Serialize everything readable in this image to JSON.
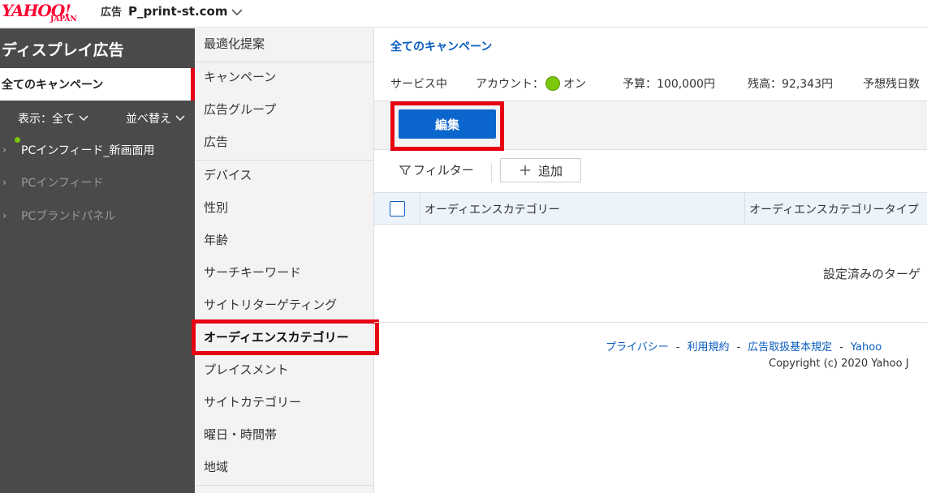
{
  "header": {
    "logo_text": "YAHOO!",
    "logo_sub": "JAPAN",
    "logo_ad": "広告",
    "account_name": "P_print-st.com"
  },
  "sidebar": {
    "title": "ディスプレイ広告",
    "active_item": "全てのキャンペーン",
    "filter_label": "表示：全て",
    "sort_label": "並べ替え",
    "campaigns": [
      {
        "label": "PCインフィード_新画面用",
        "status": "active"
      },
      {
        "label": "PCインフィード",
        "status": "inactive"
      },
      {
        "label": "PCブランドパネル",
        "status": "inactive"
      }
    ]
  },
  "midnav": {
    "items": [
      {
        "label": "最適化提案"
      },
      {
        "label": "キャンペーン"
      },
      {
        "label": "広告グループ"
      },
      {
        "label": "広告"
      },
      {
        "label": "デバイス"
      },
      {
        "label": "性別"
      },
      {
        "label": "年齢"
      },
      {
        "label": "サーチキーワード"
      },
      {
        "label": "サイトリターゲティング"
      },
      {
        "label": "オーディエンスカテゴリー"
      },
      {
        "label": "プレイスメント"
      },
      {
        "label": "サイトカテゴリー"
      },
      {
        "label": "曜日・時間帯"
      },
      {
        "label": "地域"
      }
    ],
    "selected_index": 9
  },
  "main": {
    "breadcrumb": "全てのキャンペーン",
    "status": {
      "service": "サービス中",
      "account_label": "アカウント：",
      "account_state": "オン",
      "budget": "予算：100,000円",
      "balance": "残高：92,343円",
      "days_left": "予想残日数"
    },
    "edit_button": "編集",
    "filter_button": "フィルター",
    "add_button": "追加",
    "table": {
      "columns": [
        "オーディエンスカテゴリー",
        "オーディエンスカテゴリータイプ"
      ]
    },
    "empty_message": "設定済みのターゲ"
  },
  "footer": {
    "links": [
      "プライバシー",
      "利用規約",
      "広告取扱基本規定",
      "Yahoo"
    ],
    "copyright": "Copyright (c) 2020 Yahoo J"
  },
  "colors": {
    "accent_red": "#e60012",
    "primary_blue": "#0a66cc",
    "link_blue": "#0a5cbf",
    "sidebar_dark": "#4a4a4a",
    "status_green": "#7ac70c"
  }
}
